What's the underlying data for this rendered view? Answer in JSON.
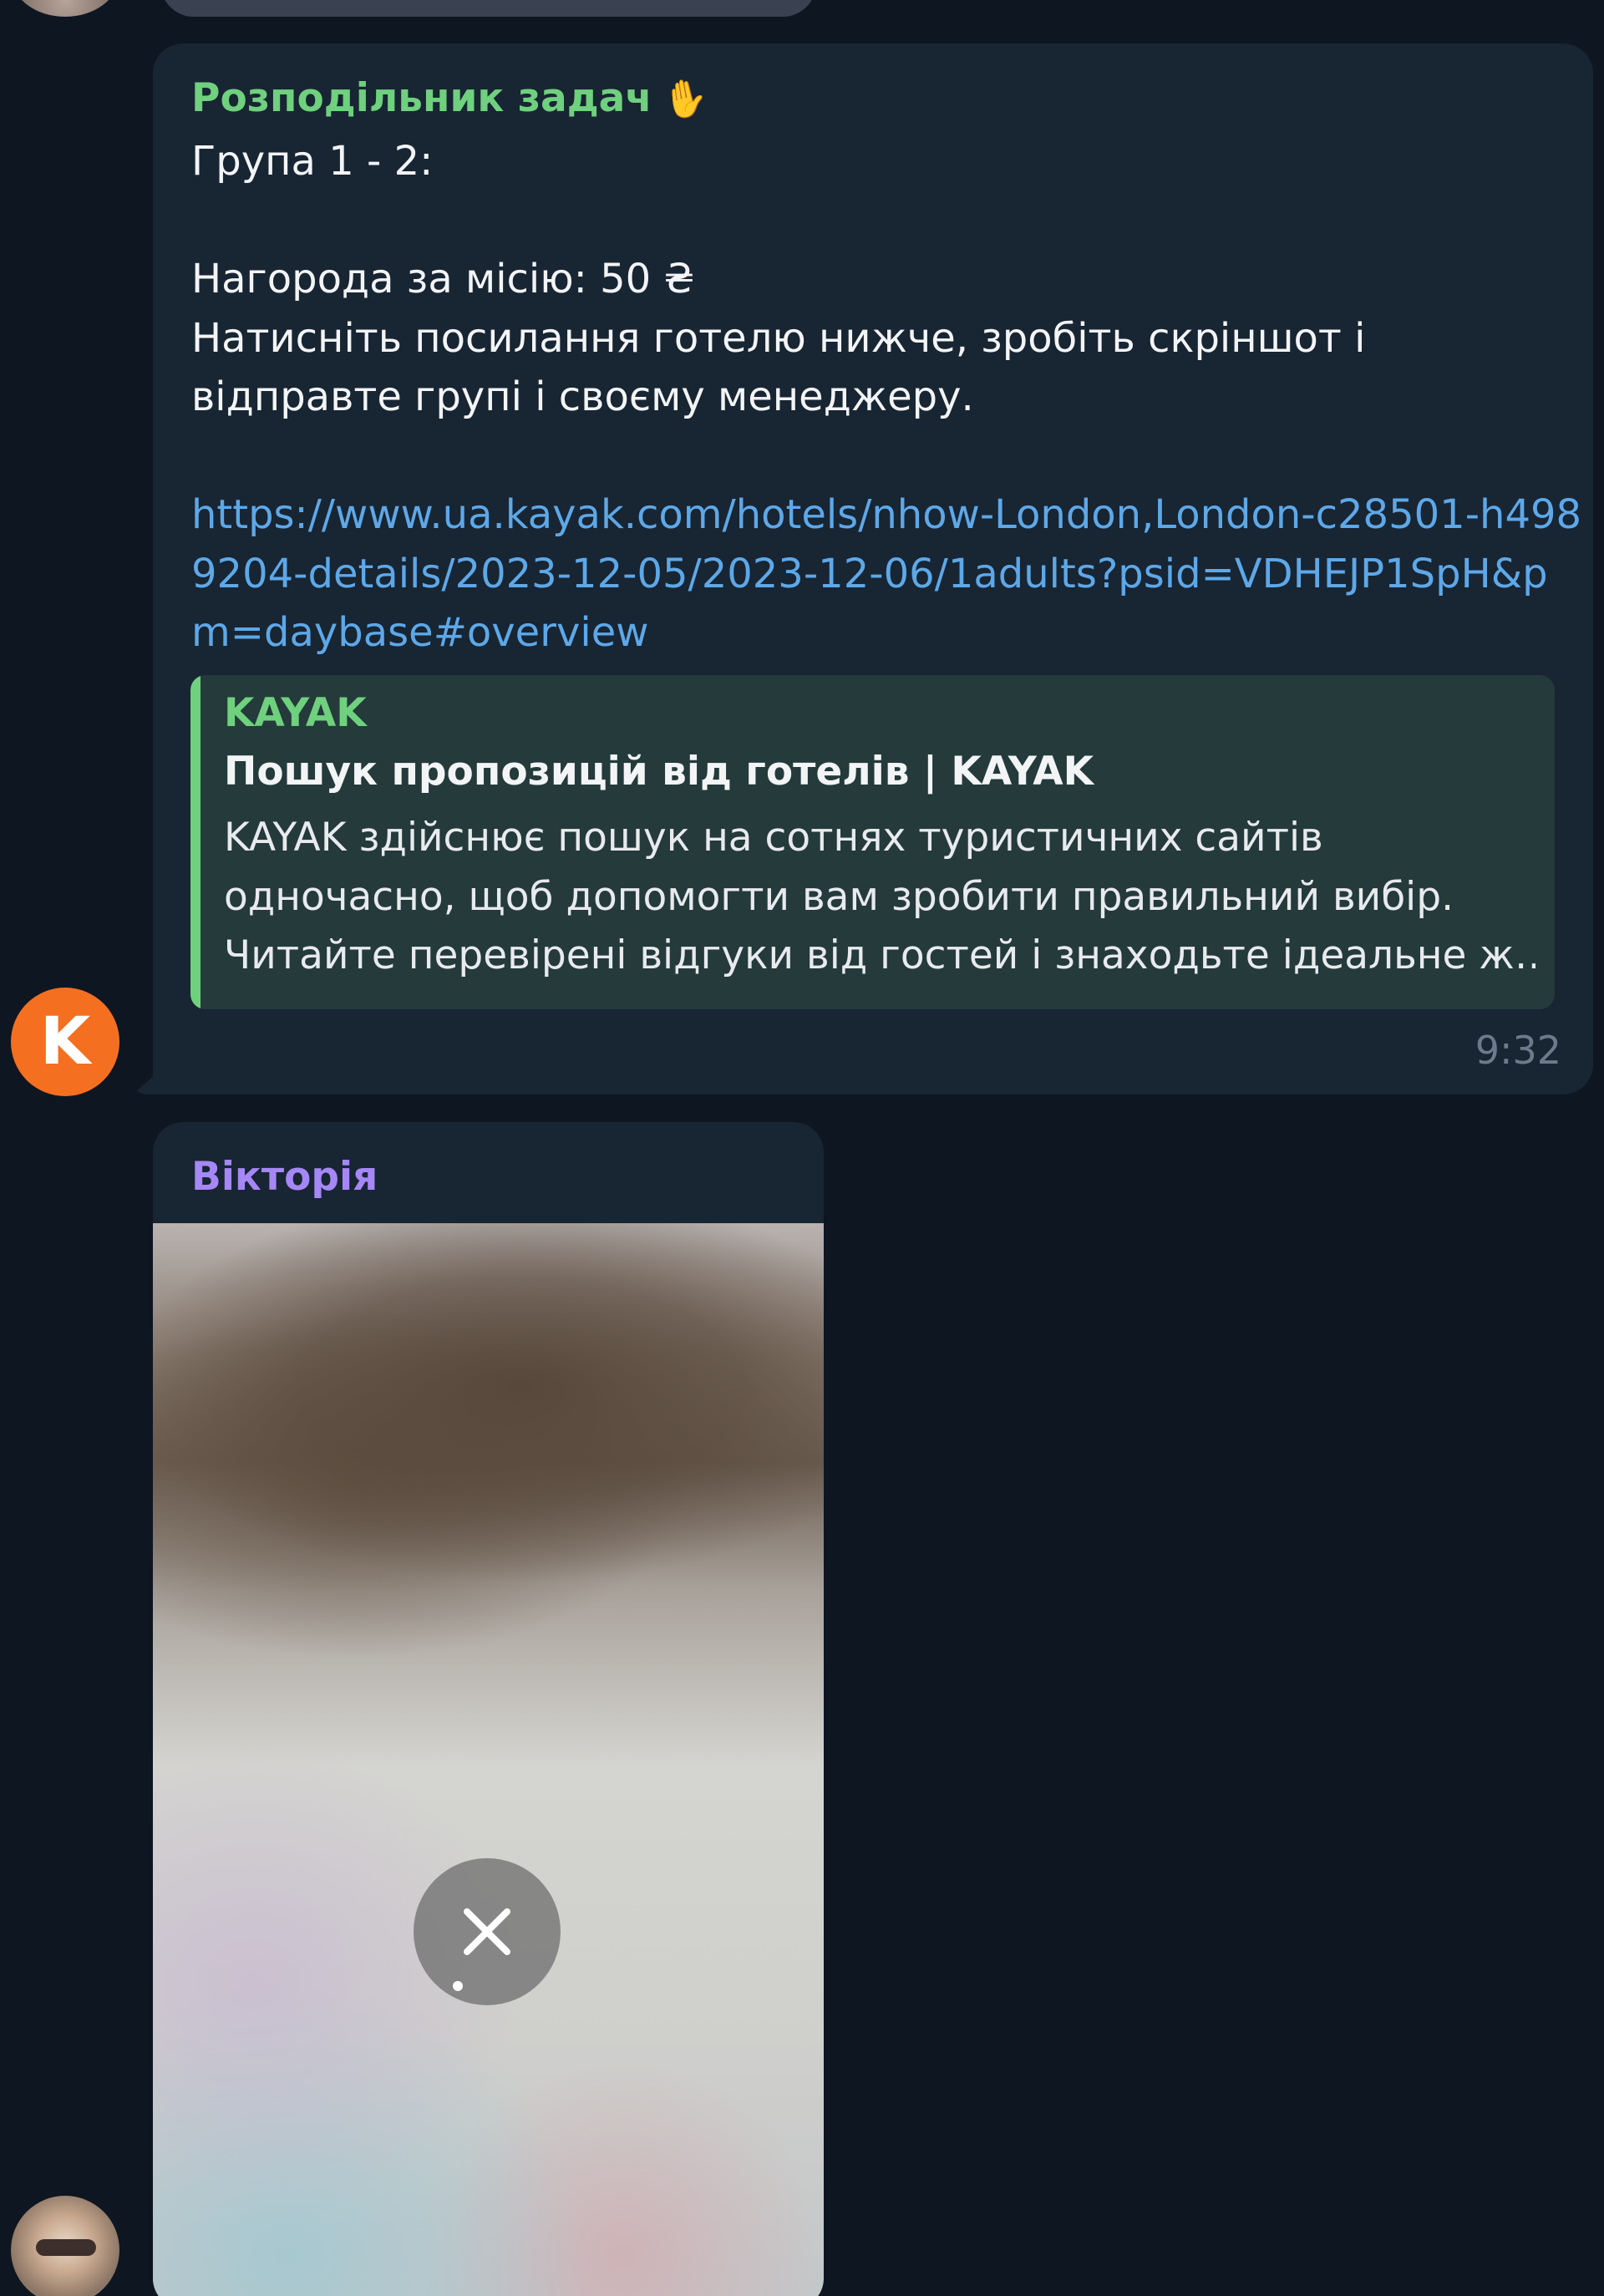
{
  "messages": [
    {
      "sender": "Розподільник задач",
      "sender_icon": "waving-hand-icon",
      "sender_color": "#6fd07e",
      "text": "Група 1 - 2:\n\nНагорода за місію: 50 ₴\nНатисніть посилання готелю нижче, зробіть скріншот і відправте групі і своєму менеджеру.",
      "link": "https://www.ua.kayak.com/hotels/nhow-London,London-c28501-h4989204-details/2023-12-05/2023-12-06/1adults?psid=VDHEJP1SpH&pm=daybase#overview",
      "preview": {
        "site": "KAYAK",
        "title": "Пошук пропозицій від готелів | KAYAK",
        "description": "KAYAK здійснює пошук на сотнях туристичних сайтів\nодночасно, щоб допомогти вам зробити правильний вибір.\nЧитайте перевірені відгуки від гостей і знаходьте ідеальне ж…"
      },
      "time": "9:32",
      "avatar_letter": "K",
      "avatar_color": "#f56f20"
    },
    {
      "sender": "Вікторія",
      "sender_color": "#a587f5",
      "attachment": "photo",
      "attachment_action_icon": "close-icon"
    }
  ]
}
